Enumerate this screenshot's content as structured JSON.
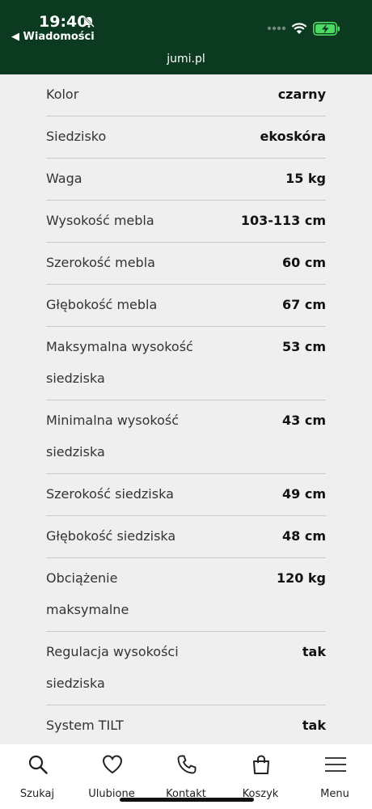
{
  "status": {
    "time": "19:40",
    "back_label": "◀ Wiadomości",
    "url": "jumi.pl",
    "battery_color": "#4cd964"
  },
  "specs": [
    {
      "label": "Kolor",
      "value": "czarny"
    },
    {
      "label": "Siedzisko",
      "value": "ekoskóra"
    },
    {
      "label": "Waga",
      "value": "15 kg"
    },
    {
      "label": "Wysokość mebla",
      "value": "103-113 cm"
    },
    {
      "label": "Szerokość mebla",
      "value": "60 cm"
    },
    {
      "label": "Głębokość mebla",
      "value": "67 cm"
    },
    {
      "label": "Maksymalna wysokość siedziska",
      "value": "53 cm"
    },
    {
      "label": "Minimalna wysokość siedziska",
      "value": "43 cm"
    },
    {
      "label": "Szerokość siedziska",
      "value": "49 cm"
    },
    {
      "label": "Głębokość siedziska",
      "value": "48 cm"
    },
    {
      "label": "Obciążenie maksymalne",
      "value": "120 kg"
    },
    {
      "label": "Regulacja wysokości siedziska",
      "value": "tak"
    },
    {
      "label": "System TILT",
      "value": "tak"
    }
  ],
  "tabbar": [
    {
      "label": "Szukaj",
      "icon": "search-icon"
    },
    {
      "label": "Ulubione",
      "icon": "heart-icon"
    },
    {
      "label": "Kontakt",
      "icon": "phone-icon"
    },
    {
      "label": "Koszyk",
      "icon": "bag-icon"
    },
    {
      "label": "Menu",
      "icon": "menu-icon"
    }
  ]
}
